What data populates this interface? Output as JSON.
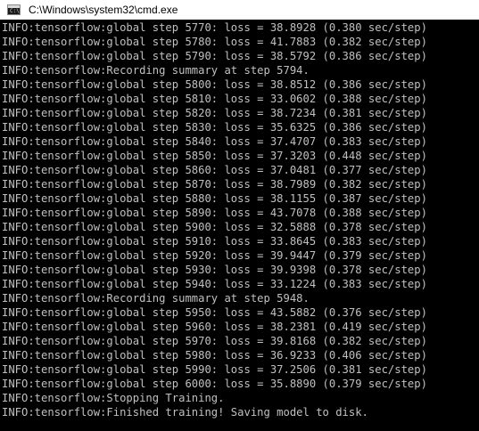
{
  "window": {
    "title": "C:\\Windows\\system32\\cmd.exe",
    "app_icon": "cmd-icon",
    "icon_glyph": "C:\\"
  },
  "console": {
    "lines": [
      "INFO:tensorflow:global step 5770: loss = 38.8928 (0.380 sec/step)",
      "INFO:tensorflow:global step 5780: loss = 41.7883 (0.382 sec/step)",
      "INFO:tensorflow:global step 5790: loss = 38.5792 (0.386 sec/step)",
      "INFO:tensorflow:Recording summary at step 5794.",
      "INFO:tensorflow:global step 5800: loss = 38.8512 (0.386 sec/step)",
      "INFO:tensorflow:global step 5810: loss = 33.0602 (0.388 sec/step)",
      "INFO:tensorflow:global step 5820: loss = 38.7234 (0.381 sec/step)",
      "INFO:tensorflow:global step 5830: loss = 35.6325 (0.386 sec/step)",
      "INFO:tensorflow:global step 5840: loss = 37.4707 (0.383 sec/step)",
      "INFO:tensorflow:global step 5850: loss = 37.3203 (0.448 sec/step)",
      "INFO:tensorflow:global step 5860: loss = 37.0481 (0.377 sec/step)",
      "INFO:tensorflow:global step 5870: loss = 38.7989 (0.382 sec/step)",
      "INFO:tensorflow:global step 5880: loss = 38.1155 (0.387 sec/step)",
      "INFO:tensorflow:global step 5890: loss = 43.7078 (0.388 sec/step)",
      "INFO:tensorflow:global step 5900: loss = 32.5888 (0.378 sec/step)",
      "INFO:tensorflow:global step 5910: loss = 33.8645 (0.383 sec/step)",
      "INFO:tensorflow:global step 5920: loss = 39.9447 (0.379 sec/step)",
      "INFO:tensorflow:global step 5930: loss = 39.9398 (0.378 sec/step)",
      "INFO:tensorflow:global step 5940: loss = 33.1224 (0.383 sec/step)",
      "INFO:tensorflow:Recording summary at step 5948.",
      "INFO:tensorflow:global step 5950: loss = 43.5882 (0.376 sec/step)",
      "INFO:tensorflow:global step 5960: loss = 38.2381 (0.419 sec/step)",
      "INFO:tensorflow:global step 5970: loss = 39.8168 (0.382 sec/step)",
      "INFO:tensorflow:global step 5980: loss = 36.9233 (0.406 sec/step)",
      "INFO:tensorflow:global step 5990: loss = 37.2506 (0.381 sec/step)",
      "INFO:tensorflow:global step 6000: loss = 35.8890 (0.379 sec/step)",
      "INFO:tensorflow:Stopping Training.",
      "INFO:tensorflow:Finished training! Saving model to disk."
    ]
  },
  "colors": {
    "background": "#000000",
    "text": "#c0c0c0",
    "titlebar": "#ffffff"
  }
}
